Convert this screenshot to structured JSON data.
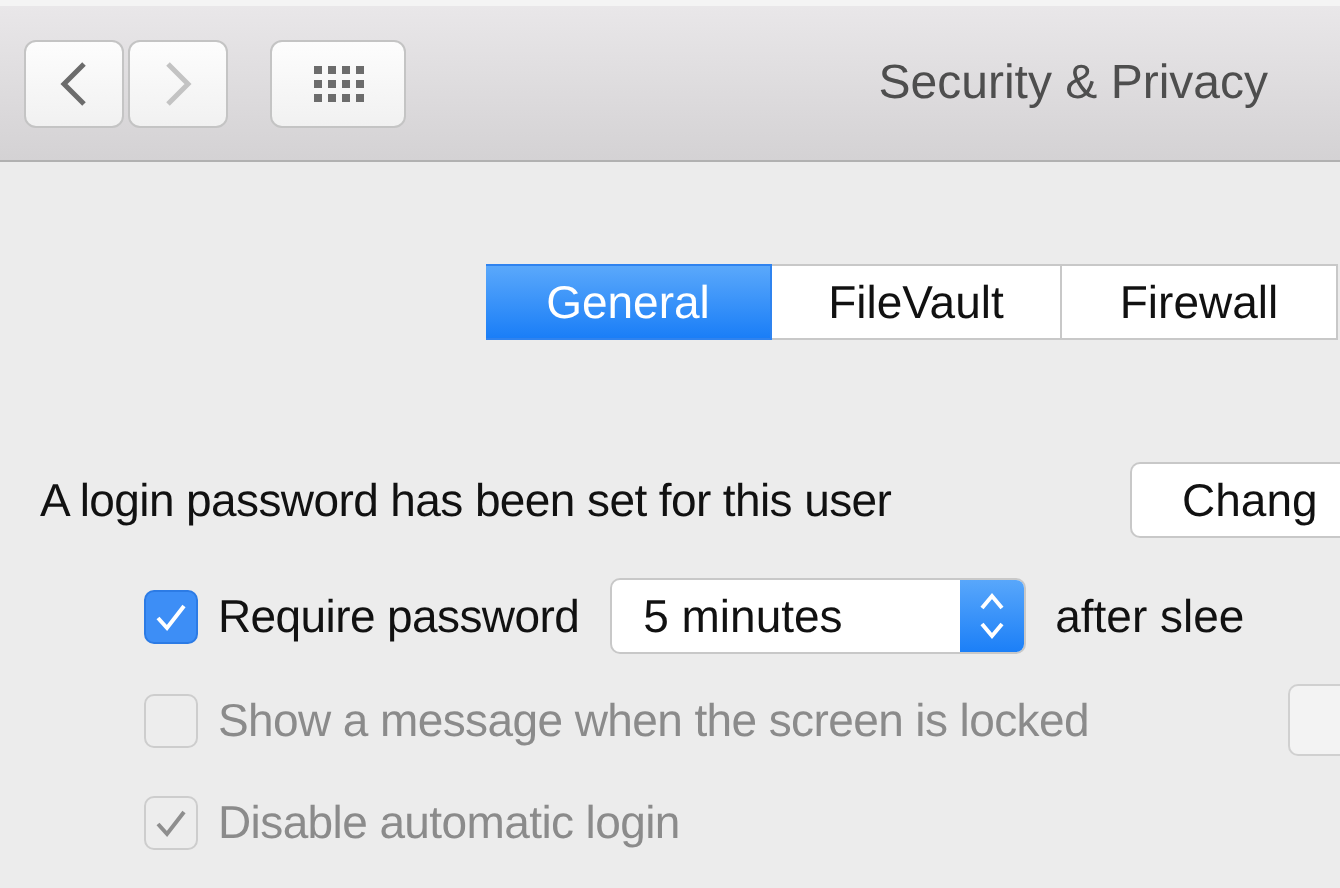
{
  "window": {
    "title": "Security & Privacy"
  },
  "toolbar": {
    "buttons": [
      {
        "kind": "back",
        "disabled": false
      },
      {
        "kind": "forward",
        "disabled": true
      },
      {
        "kind": "grid",
        "disabled": false
      }
    ]
  },
  "tabs": [
    {
      "label": "General",
      "selected": true
    },
    {
      "label": "FileVault",
      "selected": false
    },
    {
      "label": "Firewall",
      "selected": false
    }
  ],
  "login": {
    "text": "A login password has been set for this user",
    "button": "Chang"
  },
  "options": [
    {
      "kind": "popup",
      "label": "Require password",
      "checked": true,
      "disabled": false,
      "popup": "5 minutes",
      "suffix": "after slee"
    },
    {
      "kind": "button",
      "label": "Show a message when the screen is locked",
      "checked": false,
      "disabled": true
    },
    {
      "kind": "plain",
      "label": "Disable automatic login",
      "checked": true,
      "disabled": true
    }
  ]
}
